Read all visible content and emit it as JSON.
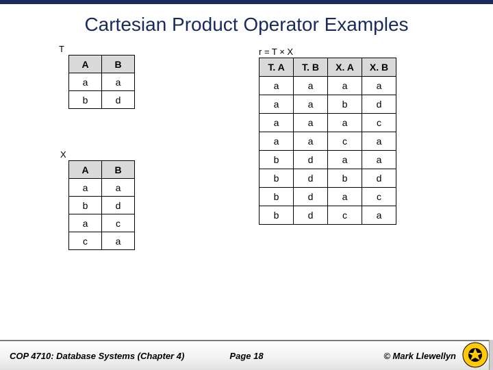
{
  "title": "Cartesian Product Operator Examples",
  "tableT": {
    "label": "T",
    "headers": [
      "A",
      "B"
    ],
    "rows": [
      [
        "a",
        "a"
      ],
      [
        "b",
        "d"
      ]
    ]
  },
  "tableX": {
    "label": "X",
    "headers": [
      "A",
      "B"
    ],
    "rows": [
      [
        "a",
        "a"
      ],
      [
        "b",
        "d"
      ],
      [
        "a",
        "c"
      ],
      [
        "c",
        "a"
      ]
    ]
  },
  "tableR": {
    "label": "r = T × X",
    "headers": [
      "T. A",
      "T. B",
      "X. A",
      "X. B"
    ],
    "rows": [
      [
        "a",
        "a",
        "a",
        "a"
      ],
      [
        "a",
        "a",
        "b",
        "d"
      ],
      [
        "a",
        "a",
        "a",
        "c"
      ],
      [
        "a",
        "a",
        "c",
        "a"
      ],
      [
        "b",
        "d",
        "a",
        "a"
      ],
      [
        "b",
        "d",
        "b",
        "d"
      ],
      [
        "b",
        "d",
        "a",
        "c"
      ],
      [
        "b",
        "d",
        "c",
        "a"
      ]
    ]
  },
  "footer": {
    "course": "COP 4710: Database Systems  (Chapter 4)",
    "page": "Page 18",
    "copyright": "© Mark Llewellyn"
  }
}
